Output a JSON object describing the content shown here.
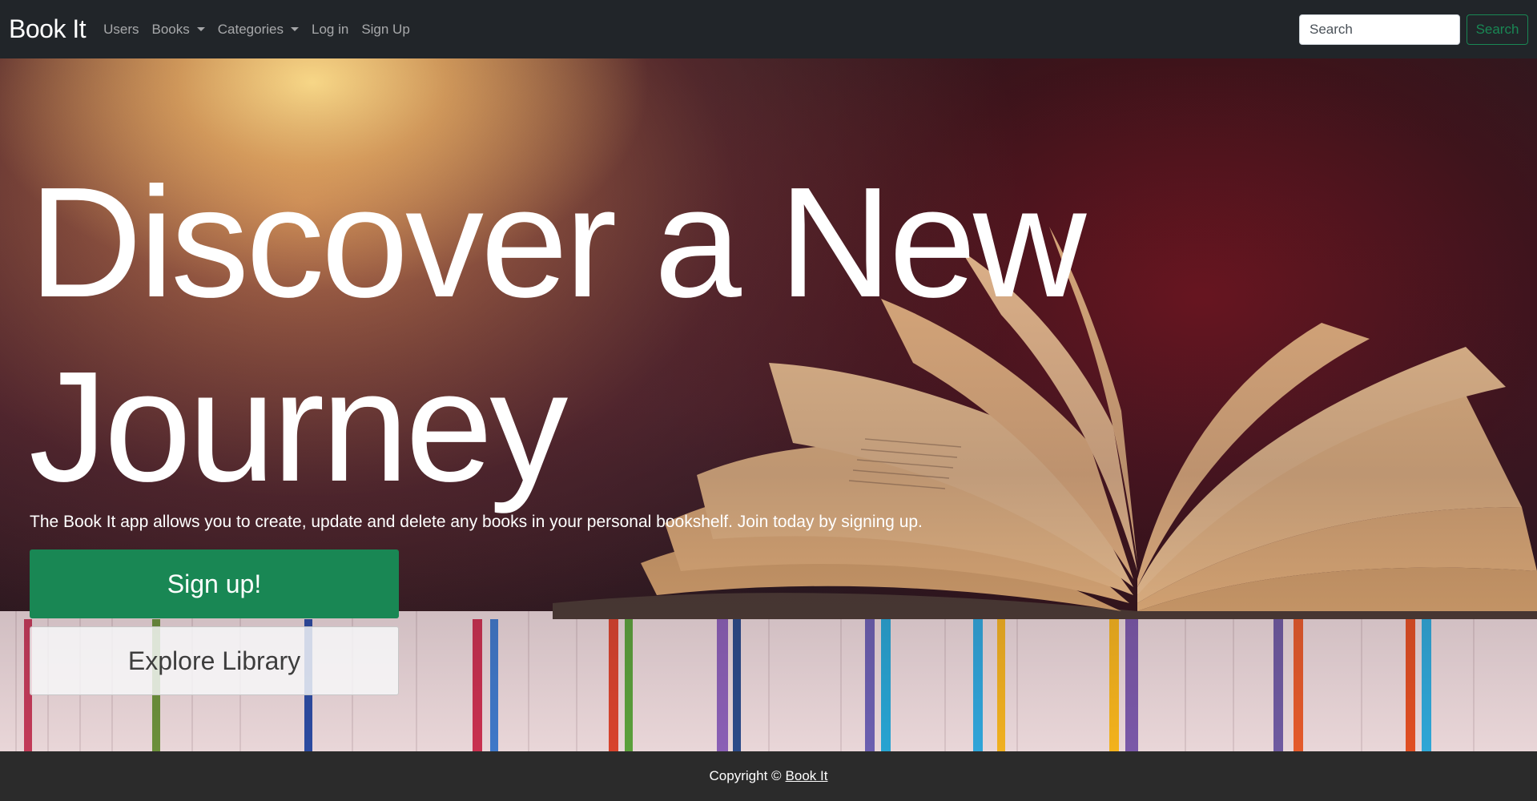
{
  "navbar": {
    "brand": "Book It",
    "links": [
      "Users",
      "Books",
      "Categories",
      "Log in",
      "Sign Up"
    ],
    "search_placeholder": "Search",
    "search_button": "Search"
  },
  "hero": {
    "title": "Discover a New Journey",
    "subtitle": "The Book It app allows you to create, update and delete any books in your personal bookshelf. Join today by signing up.",
    "signup_button": "Sign up!",
    "explore_button": "Explore Library"
  },
  "footer": {
    "copyright": "Copyright ©",
    "link": "Book It"
  },
  "colors": {
    "navbar_bg": "#212529",
    "success": "#198754",
    "footer_bg": "#2b2b2b"
  }
}
